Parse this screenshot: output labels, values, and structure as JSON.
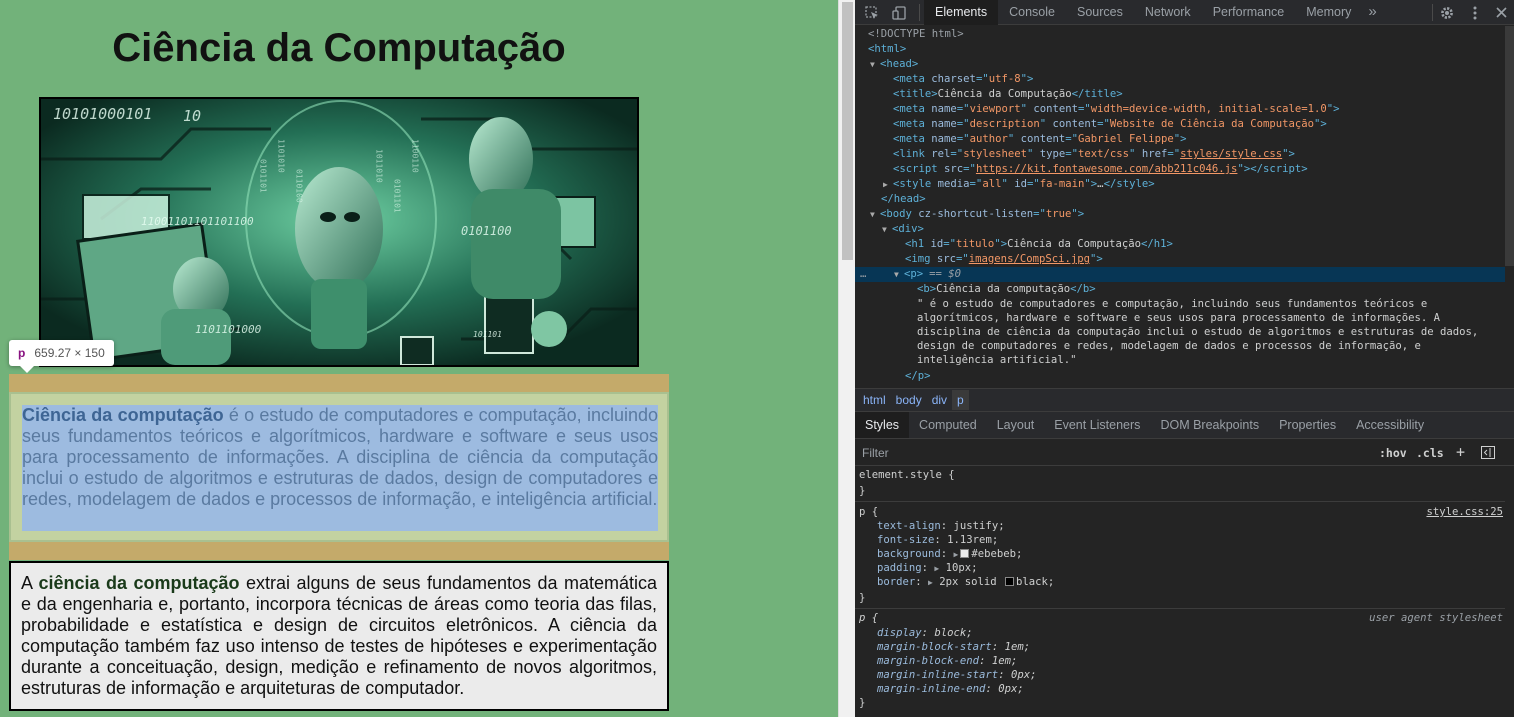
{
  "page": {
    "heading": "Ciência da Computação",
    "hero_image_alt": "imagens/CompSci.jpg",
    "hero_texts": [
      "10101000101",
      "10",
      "11001101101101100",
      "0101100",
      "1101101000",
      "101101"
    ],
    "tooltip": {
      "tag": "p",
      "dims": "659.27 × 150"
    },
    "paragraph1": {
      "bold": "Ciência da computação",
      "rest": " é o estudo de computadores e computação, incluindo seus fundamentos teóricos e algorítmicos, hardware e software e seus usos para processamento de informações. A disciplina de ciência da computação inclui o estudo de algoritmos e estruturas de dados, design de computadores e redes, modelagem de dados e processos de informação, e inteligência artificial."
    },
    "paragraph2": {
      "before": "A ",
      "bold": "ciência da computação",
      "rest": " extrai alguns de seus fundamentos da matemática e da engenharia e, portanto, incorpora técnicas de áreas como teoria das filas, probabilidade e estatística e design de circuitos eletrônicos. A ciência da computação também faz uso intenso de testes de hipóteses e experimentação durante a conceituação, design, medição e refinamento de novos algoritmos, estruturas de informação e arquiteturas de computador."
    }
  },
  "devtools": {
    "tabs": [
      "Elements",
      "Console",
      "Sources",
      "Network",
      "Performance",
      "Memory"
    ],
    "active_tab": "Elements",
    "more_tabs": "»",
    "dom": {
      "doctype": "<!DOCTYPE html>",
      "html": "<html>",
      "head": "<head>",
      "meta_charset": [
        "<meta ",
        "charset",
        "=\"",
        "utf-8",
        "\">"
      ],
      "title": [
        "<title>",
        "Ciência da Computação",
        "</title>"
      ],
      "meta_viewport": [
        "name",
        "viewport",
        "content",
        "width=device-width, initial-scale=1.0"
      ],
      "meta_description": [
        "name",
        "description",
        "content",
        "Website de Ciência da Computação"
      ],
      "meta_author": [
        "name",
        "author",
        "content",
        "Gabriel Felippe"
      ],
      "link": [
        "rel",
        "stylesheet",
        "type",
        "text/css",
        "href",
        "styles/style.css"
      ],
      "script": [
        "src",
        "https://kit.fontawesome.com/abb211c046.js"
      ],
      "style_el": [
        "media",
        "all",
        "id",
        "fa-main"
      ],
      "head_close": "</head>",
      "body": [
        "cz-shortcut-listen",
        "true"
      ],
      "div": "<div>",
      "h1": [
        "id",
        "titulo",
        "Ciência da Computação"
      ],
      "img": [
        "src",
        "imagens/CompSci.jpg"
      ],
      "p_sel_marker": "== $0",
      "p_b": "Ciência da computação",
      "p_text_lines": [
        "\" é o estudo de computadores e computação, incluindo seus fundamentos teóricos e",
        "algorítmicos, hardware e software e seus usos para processamento de informações. A",
        "disciplina de ciência da computação inclui o estudo de algoritmos e estruturas de dados,",
        "design de computadores e redes, modelagem de dados e processos de informação, e",
        "inteligência artificial.\""
      ],
      "p_close": "</p>"
    },
    "breadcrumb": [
      "html",
      "body",
      "div",
      "p"
    ],
    "style_tabs": [
      "Styles",
      "Computed",
      "Layout",
      "Event Listeners",
      "DOM Breakpoints",
      "Properties",
      "Accessibility"
    ],
    "filter_placeholder": "Filter",
    "hov": ":hov",
    "cls": ".cls",
    "rules": {
      "element_style": "element.style {",
      "close": "}",
      "p_selector": "p {",
      "p_source": "style.css:25",
      "p_decls": [
        {
          "prop": "text-align",
          "val": "justify;"
        },
        {
          "prop": "font-size",
          "val": "1.13rem;"
        },
        {
          "prop": "background",
          "val": "#ebebeb;",
          "swatch": "#ebebeb"
        },
        {
          "prop": "padding",
          "val": "10px;"
        },
        {
          "prop": "border",
          "val": "2px solid ",
          "val2": "black;",
          "swatch": "#000000"
        }
      ],
      "ua_source": "user agent stylesheet",
      "ua_decls": [
        {
          "prop": "display",
          "val": "block;"
        },
        {
          "prop": "margin-block-start",
          "val": "1em;"
        },
        {
          "prop": "margin-block-end",
          "val": "1em;"
        },
        {
          "prop": "margin-inline-start",
          "val": "0px;"
        },
        {
          "prop": "margin-inline-end",
          "val": "0px;"
        }
      ]
    }
  }
}
